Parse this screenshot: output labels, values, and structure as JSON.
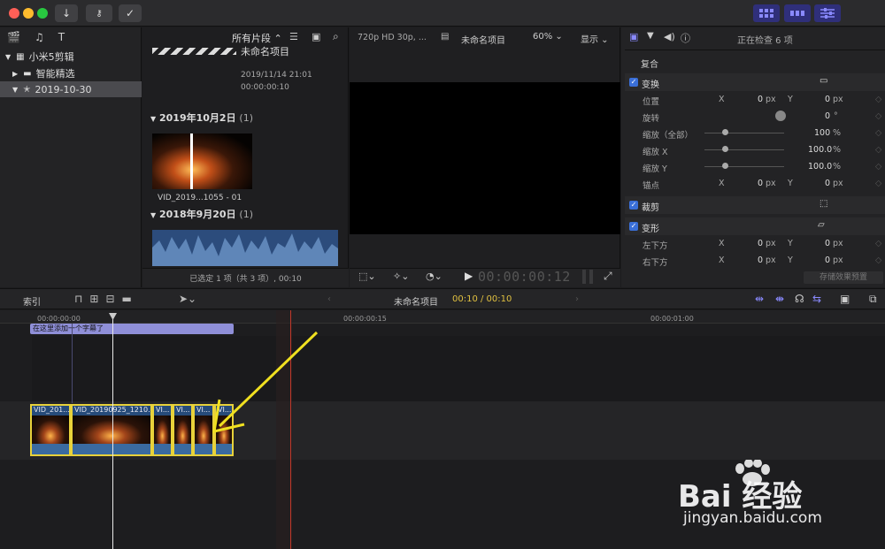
{
  "library": {
    "name": "小米5剪辑",
    "items": [
      {
        "label": "智能精选"
      },
      {
        "label": "2019-10-30"
      }
    ]
  },
  "browser": {
    "filter": "所有片段",
    "project": {
      "title": "未命名项目",
      "date": "2019/11/14 21:01",
      "duration": "00:00:00:10"
    },
    "groups": [
      {
        "date": "2019年10月2日",
        "count": "(1)",
        "clip": "VID_2019...1055 - 01"
      },
      {
        "date": "2018年9月20日",
        "count": "(1)"
      }
    ],
    "status": "已选定 1 项（共 3 项）, 00:10"
  },
  "viewer": {
    "format": "720p HD 30p, ...",
    "project": "未命名项目",
    "zoom": "60%",
    "display": "显示",
    "timecode": "00:00:00:12"
  },
  "inspector": {
    "title": "正在检查 6 项",
    "composite": "复合",
    "transform": "变换",
    "rows": [
      {
        "label": "位置",
        "x": "0",
        "xunit": "px",
        "y": "0",
        "yunit": "px"
      },
      {
        "label": "旋转",
        "value": "0",
        "unit": "°"
      },
      {
        "label": "缩放（全部）",
        "value": "100",
        "unit": "%"
      },
      {
        "label": "缩放 X",
        "value": "100.0",
        "unit": "%"
      },
      {
        "label": "缩放 Y",
        "value": "100.0",
        "unit": "%"
      },
      {
        "label": "锚点",
        "x": "0",
        "xunit": "px",
        "y": "0",
        "yunit": "px"
      }
    ],
    "crop": "裁剪",
    "distort": "变形",
    "distort_rows": [
      {
        "label": "左下方",
        "x": "0",
        "xunit": "px",
        "y": "0",
        "yunit": "px"
      },
      {
        "label": "右下方",
        "x": "0",
        "xunit": "px",
        "y": "0",
        "yunit": "px"
      }
    ],
    "save_preset": "存储效果预置"
  },
  "timeline": {
    "index": "索引",
    "project": "未命名项目",
    "position": "00:10 / 00:10",
    "ruler": [
      "00:00:00:00",
      "00:00:00:15",
      "00:00:01:00"
    ],
    "title_clip": "在这里添加一个字幕了",
    "clips": [
      "VID_201...",
      "VID_20190925_1210...",
      "VI...",
      "VI...",
      "VI...",
      "VI..."
    ]
  },
  "watermark": {
    "brand": "Bai  经验",
    "url": "jingyan.baidu.com"
  }
}
